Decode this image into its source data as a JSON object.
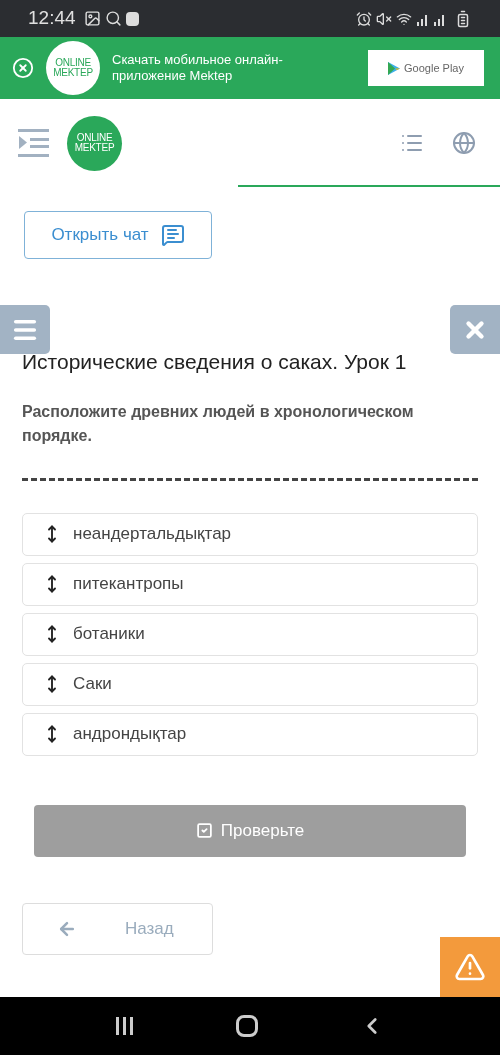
{
  "status_bar": {
    "time": "12:44"
  },
  "app_banner": {
    "logo": [
      "ONLINE",
      "MEKTEP"
    ],
    "text": "Скачать мобильное онлайн-приложение Mektep",
    "store_button": "Google Play"
  },
  "header": {
    "logo": [
      "ONLINE",
      "MEKTEP"
    ]
  },
  "chat_button": "Открыть чат",
  "lesson_title": "Исторические сведения о саках. Урок 1",
  "question": "Расположите древних людей в хронологическом порядке.",
  "items": [
    {
      "label": "неандертальдықтар"
    },
    {
      "label": "питекантропы"
    },
    {
      "label": "ботаники"
    },
    {
      "label": "Саки"
    },
    {
      "label": "андрондықтар"
    }
  ],
  "check_button": {
    "label": "Проверьте",
    "disabled": true
  },
  "back_button": "Назад"
}
